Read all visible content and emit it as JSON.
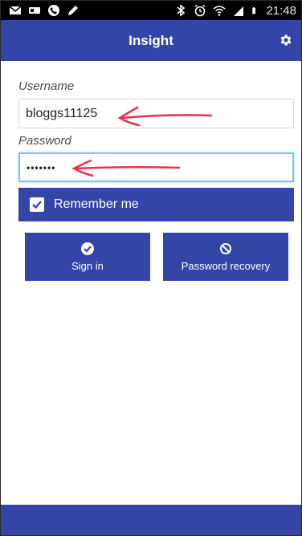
{
  "status_bar": {
    "time": "21:48",
    "left_icons": [
      "gmail-icon",
      "sim-icon",
      "phone-icon",
      "pencil-icon"
    ],
    "right_icons": [
      "bluetooth-icon",
      "alarm-icon",
      "wifi-icon",
      "signal-icon",
      "battery-icon"
    ]
  },
  "app_bar": {
    "title": "Insight",
    "settings_icon": "gear-icon"
  },
  "form": {
    "username_label": "Username",
    "username_value": "bloggs11125",
    "password_label": "Password",
    "password_value": "•••••••",
    "remember_label": "Remember me",
    "remember_checked": true
  },
  "actions": {
    "signin_label": "Sign in",
    "signin_icon": "check-icon",
    "recovery_label": "Password recovery",
    "recovery_icon": "prohibited-icon"
  },
  "colors": {
    "primary": "#3346a8",
    "annotation": "#e8304f",
    "focus": "#7cc3f2"
  }
}
